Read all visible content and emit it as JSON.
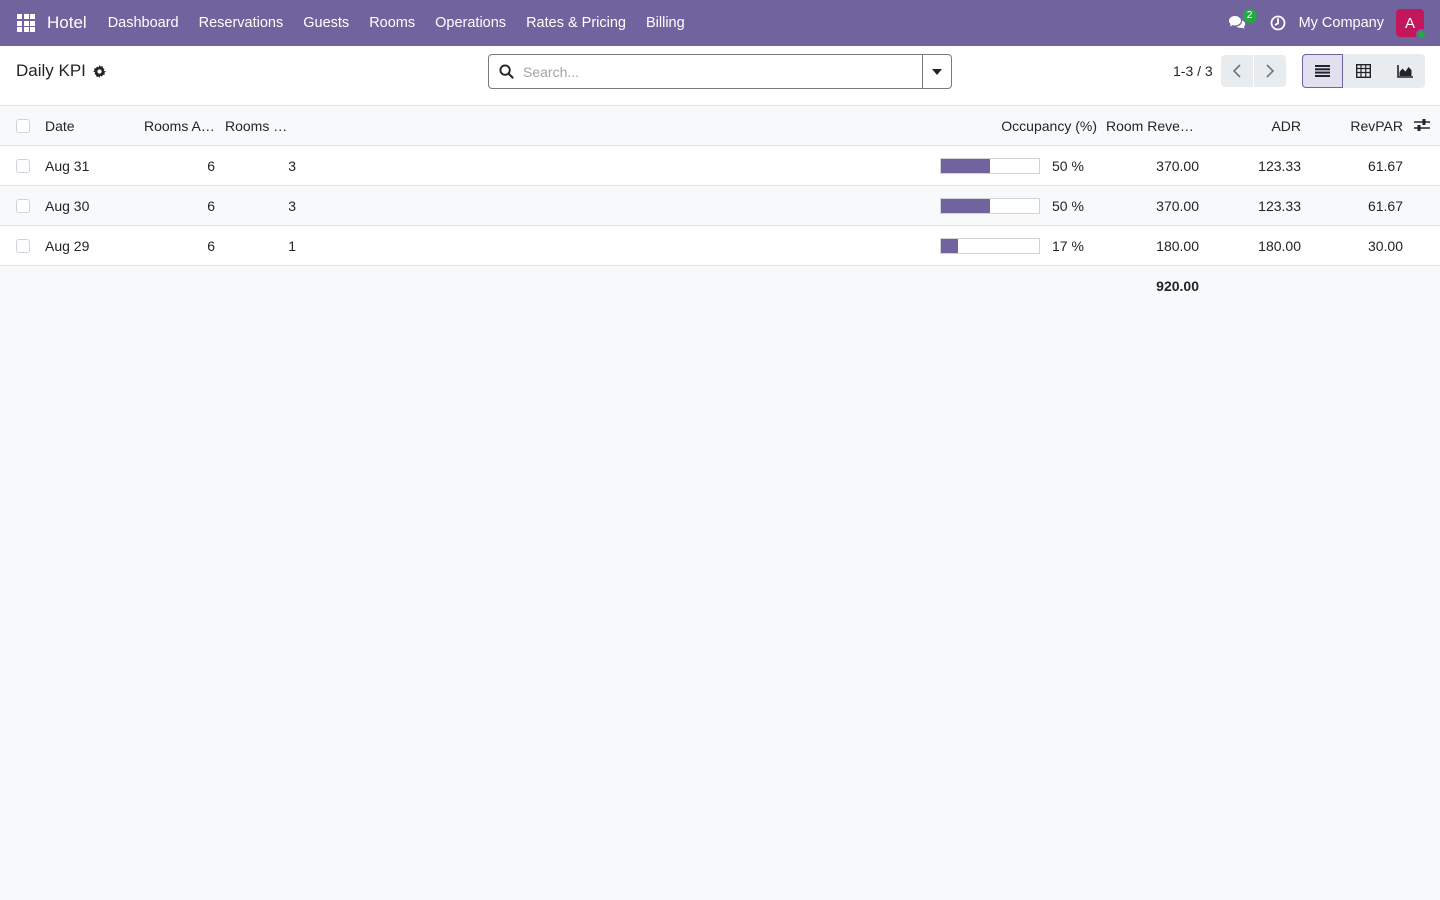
{
  "navbar": {
    "brand": "Hotel",
    "menu": [
      "Dashboard",
      "Reservations",
      "Guests",
      "Rooms",
      "Operations",
      "Rates & Pricing",
      "Billing"
    ],
    "chat_count": "2",
    "company": "My Company",
    "avatar_letter": "A",
    "accent_color": "#71639e"
  },
  "control": {
    "title": "Daily KPI",
    "search_placeholder": "Search...",
    "pager": "1-3 / 3"
  },
  "table": {
    "headers": {
      "date": "Date",
      "rooms_available": "Rooms A…",
      "rooms_sold": "Rooms …",
      "occupancy": "Occupancy (%)",
      "room_revenue": "Room Reve…",
      "adr": "ADR",
      "revpar": "RevPAR"
    },
    "rows": [
      {
        "date": "Aug 31",
        "rooms_available": "6",
        "rooms_sold": "3",
        "occupancy": 50,
        "occupancy_label": "50 %",
        "room_revenue": "370.00",
        "adr": "123.33",
        "revpar": "61.67"
      },
      {
        "date": "Aug 30",
        "rooms_available": "6",
        "rooms_sold": "3",
        "occupancy": 50,
        "occupancy_label": "50 %",
        "room_revenue": "370.00",
        "adr": "123.33",
        "revpar": "61.67"
      },
      {
        "date": "Aug 29",
        "rooms_available": "6",
        "rooms_sold": "1",
        "occupancy": 17,
        "occupancy_label": "17 %",
        "room_revenue": "180.00",
        "adr": "180.00",
        "revpar": "30.00"
      }
    ],
    "totals": {
      "room_revenue": "920.00"
    }
  }
}
